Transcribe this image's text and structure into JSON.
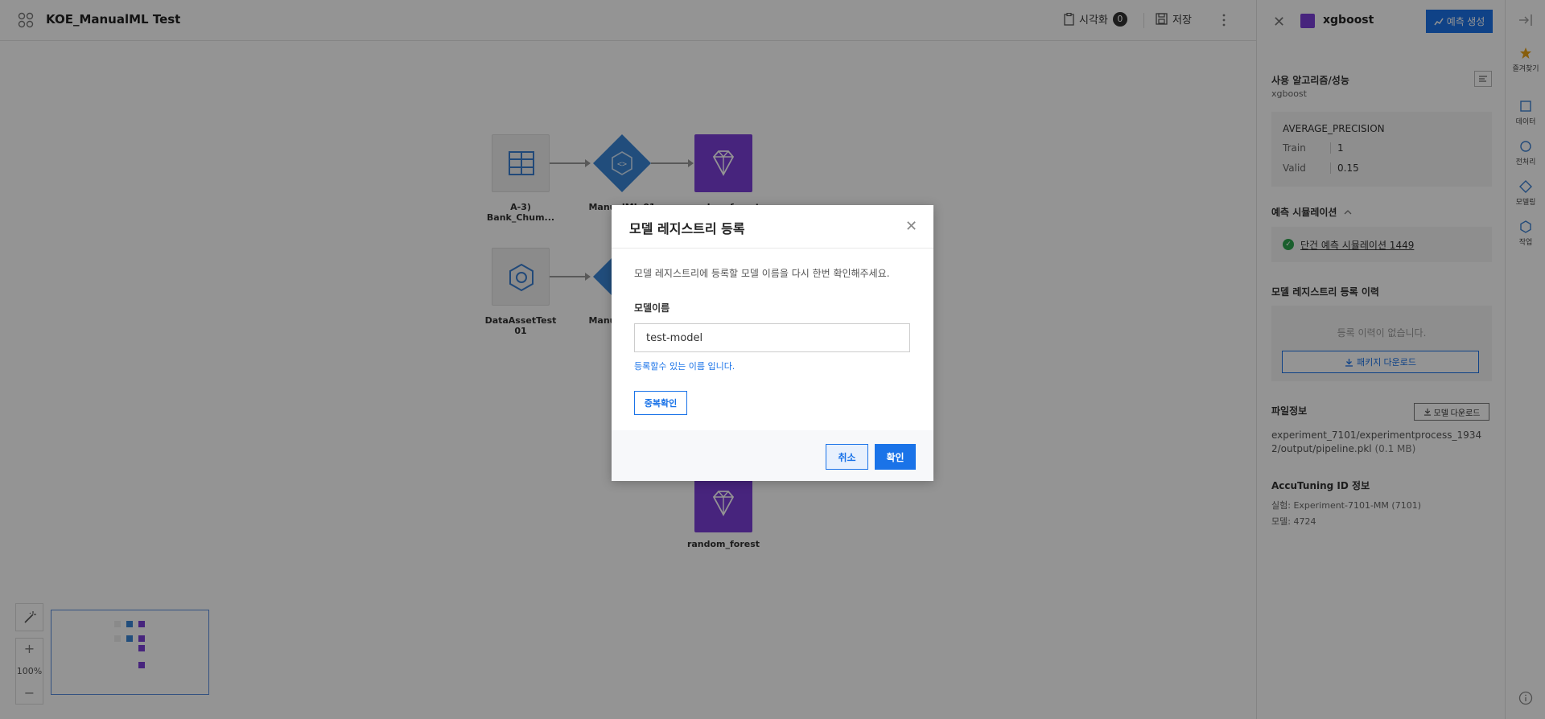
{
  "header": {
    "title": "KOE_ManualML Test",
    "visualize_label": "시각화",
    "visualize_count": "0",
    "save_label": "저장"
  },
  "canvas": {
    "nodes": [
      {
        "label_line1": "A-3)",
        "label_line2": "Bank_Chum..."
      },
      {
        "label": "ManualML-01"
      },
      {
        "label": "random_forest"
      },
      {
        "label_line1": "DataAssetTest",
        "label_line2": "01"
      },
      {
        "label": "ManualML-02"
      },
      {
        "label": "random_forest"
      }
    ],
    "zoom": "100%",
    "zoom_in": "+",
    "zoom_out": "−"
  },
  "panel": {
    "algo_name": "xgboost",
    "predict_button": "예측 생성",
    "algo_section_title": "사용 알고리즘/성능",
    "algo_sub": "xgboost",
    "metric_name": "AVERAGE_PRECISION",
    "metrics": [
      {
        "k": "Train",
        "v": "1"
      },
      {
        "k": "Valid",
        "v": "0.15"
      }
    ],
    "sim_section_title": "예측 시뮬레이션",
    "sim_link": "단건 예측 시뮬레이션 1449",
    "history_title": "모델 레지스트리 등록 이력",
    "history_empty": "등록 이력이 없습니다.",
    "package_download": "패키지 다운로드",
    "file_title": "파일정보",
    "model_download": "모델 다운로드",
    "file_path": "experiment_7101/experimentprocess_19342/output/pipeline.pkl",
    "file_size": "(0.1 MB)",
    "accu_title": "AccuTuning ID 정보",
    "experiment_line": "실험: Experiment-7101-MM (7101)",
    "model_line": "모델: 4724"
  },
  "rail": {
    "items": [
      "즐겨찾기",
      "데이터",
      "전처리",
      "모델링",
      "작업"
    ]
  },
  "modal": {
    "title": "모델 레지스트리 등록",
    "description": "모델 레지스트리에 등록할 모델 이름을 다시 한번 확인해주세요.",
    "field_label": "모델이름",
    "input_value": "test-model",
    "hint": "등록할수 있는 이름 입니다.",
    "dup_check": "중복확인",
    "cancel": "취소",
    "confirm": "확인"
  },
  "colors": {
    "accent": "#1a73e8",
    "model_node": "#7b3fd8",
    "success": "#2da44e"
  }
}
